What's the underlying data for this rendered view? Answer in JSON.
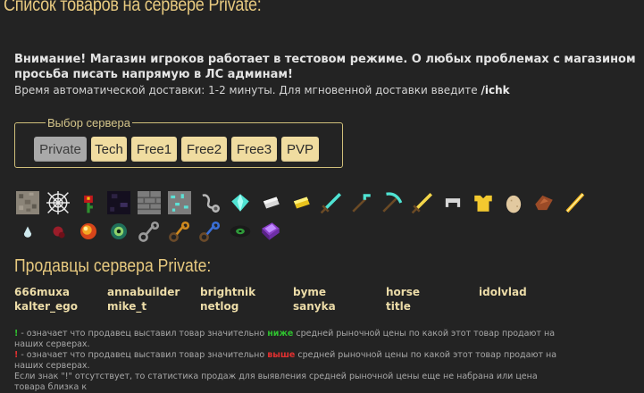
{
  "page": {
    "title": "Список товаров на сервере Private:"
  },
  "notice": {
    "bold_text": "Внимание! Магазин игроков работает в тестовом режиме. О любых проблемах с магазином просьба писать напрямую в ЛС админам!",
    "delivery_prefix": "Время автоматической доставки: 1-2 минуты. Для мгновенной доставки введите ",
    "delivery_command": "/ichk"
  },
  "server_select": {
    "legend": "Выбор сервера",
    "servers": [
      {
        "label": "Private",
        "active": true
      },
      {
        "label": "Tech",
        "active": false
      },
      {
        "label": "Free1",
        "active": false
      },
      {
        "label": "Free2",
        "active": false
      },
      {
        "label": "Free3",
        "active": false
      },
      {
        "label": "PVP",
        "active": false
      }
    ]
  },
  "items": {
    "row1": [
      "gravel-block-icon",
      "cobweb-icon",
      "red-flower-icon",
      "obsidian-block-icon",
      "stone-bricks-icon",
      "diamond-ore-icon",
      "lead-icon",
      "diamond-icon",
      "iron-ingot-icon",
      "gold-ingot-icon",
      "diamond-sword-icon",
      "diamond-hoe-icon",
      "diamond-pickaxe-icon",
      "golden-sword-icon",
      "iron-helmet-icon",
      "golden-chestplate-icon",
      "egg-icon",
      "leather-icon",
      "blaze-rod-icon"
    ],
    "row2": [
      "ghast-tear-icon",
      "nether-wart-icon",
      "fire-charge-icon",
      "ender-eye-icon",
      "chain-icon",
      "orange-chain-icon",
      "blue-chain-icon",
      "music-disc-icon",
      "enchanted-book-icon"
    ]
  },
  "sellers": {
    "title": "Продавцы сервера Private:",
    "names": [
      "666muxa",
      "annabuilder",
      "brightnik",
      "byme",
      "horse",
      "idolvlad",
      "kalter_ego",
      "mike_t",
      "netlog",
      "sanyka",
      "title"
    ]
  },
  "legend": {
    "green_mark": "!",
    "green_text_before": " - означает что продавец выставил товар значительно ",
    "green_word": "ниже",
    "green_text_after": " средней рыночной цены по какой этот товар продают на наших серверах.",
    "red_mark": "!",
    "red_text_before": " - означает что продавец выставил товар значительно ",
    "red_word": "выше",
    "red_text_after": " средней рыночной цены по какой этот товар продают на наших серверах.",
    "absent_text": "Если знак \"!\" отсутствует, то статистика продаж для выявления средней рыночной цены еще не набрана или цена товара близка к"
  },
  "colors": {
    "accent": "#e7c97f",
    "button": "#f0dca0",
    "button_active": "#a9a9a9",
    "background": "#232323"
  }
}
